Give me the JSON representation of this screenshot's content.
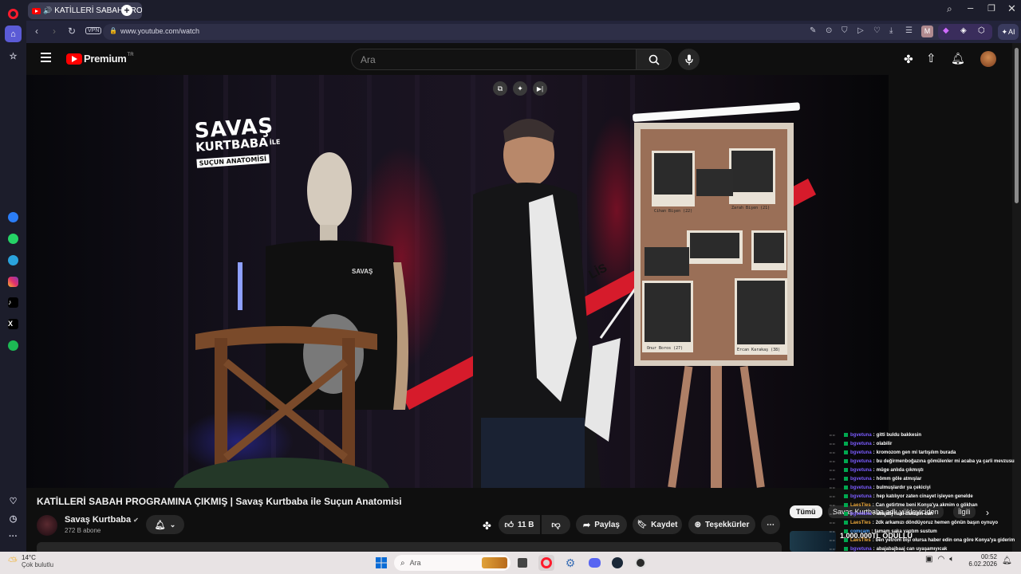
{
  "browser": {
    "tab_title": "KATİLLERİ SABAH PRO",
    "url": "www.youtube.com/watch",
    "vpn_label": "VPN",
    "profile_initial": "M",
    "ai_label": "AI"
  },
  "youtube": {
    "logo_text": "Premium",
    "region": "TR",
    "search_placeholder": "Ara"
  },
  "video": {
    "set_title_lines": [
      "SAVAŞ",
      "KURTBABA",
      "İLE",
      "SUÇUN ANATOMİSİ"
    ],
    "shirt_text": [
      "SAVAŞ"
    ],
    "board_captions": [
      "Cihan Bişen (22)",
      "Zarah Bişen (21)",
      "Onur Boros (27)",
      "Ercan Karakaş (38)"
    ],
    "tape_text": "LİS"
  },
  "info": {
    "title": "KATİLLERİ SABAH PROGRAMINA ÇIKMIŞ | Savaş Kurtbaba ile Suçun Anatomisi",
    "channel_name": "Savaş Kurtbaba",
    "subscribers": "272 B abone",
    "like_count": "11 B",
    "share_label": "Paylaş",
    "save_label": "Kaydet",
    "thanks_label": "Teşekkürler",
    "chip_all": "Tümü",
    "chip_channel": "Savaş Kurtbaba adlı yükleyiciden",
    "chip_related": "İlgili",
    "reward_text": "1.000.000TL ÖDÜLLÜ"
  },
  "chat": [
    {
      "user": "bgvetuna",
      "msg": "gitti buldu bakkesin",
      "color": "#7b5cff"
    },
    {
      "user": "bgvetuna",
      "msg": "olabilir",
      "color": "#7b5cff"
    },
    {
      "user": "bgvetuna",
      "msg": "kromozom gen mi tartışılım burada",
      "color": "#7b5cff"
    },
    {
      "user": "bgvetuna",
      "msg": "bu değirmenboğazına gömülenler mi acaba ya çarli mevzusu",
      "color": "#7b5cff"
    },
    {
      "user": "bgvetuna",
      "msg": "müge anlıda çıkmıştı",
      "color": "#7b5cff"
    },
    {
      "user": "bgvetuna",
      "msg": "hömm göle atmışlar",
      "color": "#7b5cff"
    },
    {
      "user": "bgvetuna",
      "msg": "bulmuşlardır ya çekiciyi",
      "color": "#7b5cff"
    },
    {
      "user": "bgvetuna",
      "msg": "hep katılıyor zaten cinayet işleyen genelde",
      "color": "#7b5cff"
    },
    {
      "user": "LaesTles",
      "msg": "Can getirtme beni Konya'ya akmim o gökhan",
      "color": "#e8a53a"
    },
    {
      "user": "bgvetuna",
      "msg": "abajabj hadi bakalım can",
      "color": "#7b5cff"
    },
    {
      "user": "LaesTles",
      "msg": "2dk arkamızı döndüyoruz hemen gönün başın oynuyo",
      "color": "#e8a53a"
    },
    {
      "user": "comcam",
      "msg": "tamam şaka yaptım sustum",
      "color": "#4aa3ff"
    },
    {
      "user": "LaesTles",
      "msg": "ben yetrom bişi olursa haber edin ona göre Konya'ya giderim",
      "color": "#e8a53a"
    },
    {
      "user": "bgvetuna",
      "msg": "abajabajbaaj can uyaşamıyıcak",
      "color": "#7b5cff"
    },
    {
      "user": "comcam",
      "msg": "I kustum ya",
      "color": "#4aa3ff"
    },
    {
      "user": "bgvetuna",
      "msg": "sus be",
      "color": "#7b5cff"
    }
  ],
  "taskbar": {
    "temperature": "14°C",
    "weather": "Çok bulutlu",
    "search_label": "Ara",
    "time": "00:52",
    "date": "6.02.2026"
  }
}
